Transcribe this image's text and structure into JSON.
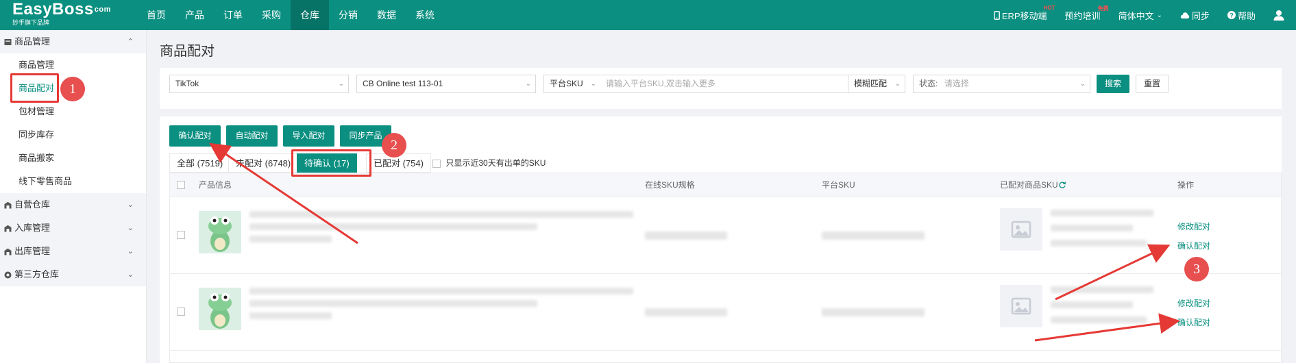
{
  "colors": {
    "brand": "#0a8f80",
    "brand_dark": "#067366",
    "annotation": "#e53935"
  },
  "logo": {
    "brand": "EasyBoss",
    "mark": "com",
    "sub": "妙手旗下品牌"
  },
  "nav": {
    "items": [
      "首页",
      "产品",
      "订单",
      "采购",
      "仓库",
      "分销",
      "数据",
      "系统"
    ],
    "active_index": 4
  },
  "top_right": {
    "erp_mobile": "ERP移动端",
    "erp_badge": "HOT",
    "training": "预约培训",
    "training_badge": "免费",
    "language": "简体中文",
    "sync": "同步",
    "help": "帮助"
  },
  "sidebar": {
    "groups": [
      {
        "label": "商品管理",
        "icon": "product-icon",
        "open": true
      },
      {
        "label": "自营仓库",
        "icon": "warehouse-icon"
      },
      {
        "label": "入库管理",
        "icon": "inbound-icon"
      },
      {
        "label": "出库管理",
        "icon": "outbound-icon"
      },
      {
        "label": "第三方仓库",
        "icon": "third-party-icon"
      }
    ],
    "subitems": [
      "商品管理",
      "商品配对",
      "包材管理",
      "同步库存",
      "商品搬家",
      "线下零售商品"
    ],
    "active_sub": 1
  },
  "page_title": "商品配对",
  "filters": {
    "platform": "TikTok",
    "shop": "CB Online test 113-01",
    "sku_type": "平台SKU",
    "sku_placeholder": "请输入平台SKU,双击输入更多",
    "match_mode": "模糊匹配",
    "status_label": "状态:",
    "status_placeholder": "请选择",
    "search": "搜索",
    "reset": "重置"
  },
  "actions": [
    "确认配对",
    "自动配对",
    "导入配对",
    "同步产品"
  ],
  "tabs": [
    "全部 (7519)",
    "未配对 (6748)",
    "待确认 (17)",
    "已配对 (754)"
  ],
  "active_tab": 2,
  "recent_only": "只显示近30天有出单的SKU",
  "table": {
    "headers": [
      "产品信息",
      "在线SKU规格",
      "平台SKU",
      "已配对商品SKU",
      "操作"
    ],
    "rows": [
      {
        "ops": [
          "修改配对",
          "确认配对"
        ]
      },
      {
        "ops": [
          "修改配对",
          "确认配对"
        ]
      }
    ]
  },
  "annotations": [
    "1",
    "2",
    "3"
  ]
}
